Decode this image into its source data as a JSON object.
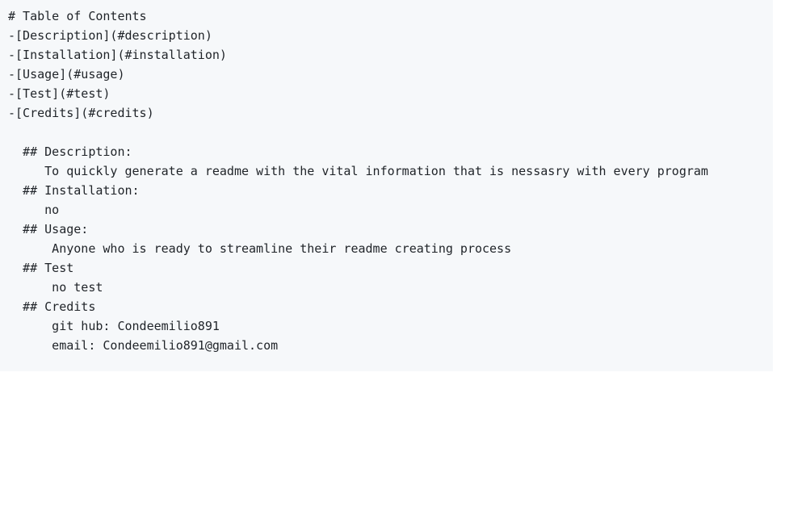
{
  "code_block": {
    "lines": [
      "# Table of Contents",
      "-[Description](#description)",
      "-[Installation](#installation)",
      "-[Usage](#usage)",
      "-[Test](#test)",
      "-[Credits](#credits)",
      "",
      "  ## Description:",
      "     To quickly generate a readme with the vital information that is nessasry with every program",
      "  ## Installation:",
      "     no",
      "  ## Usage:",
      "      Anyone who is ready to streamline their readme creating process",
      "  ## Test",
      "      no test",
      "  ## Credits",
      "      git hub: Condeemilio891",
      "      email: Condeemilio891@gmail.com"
    ]
  }
}
